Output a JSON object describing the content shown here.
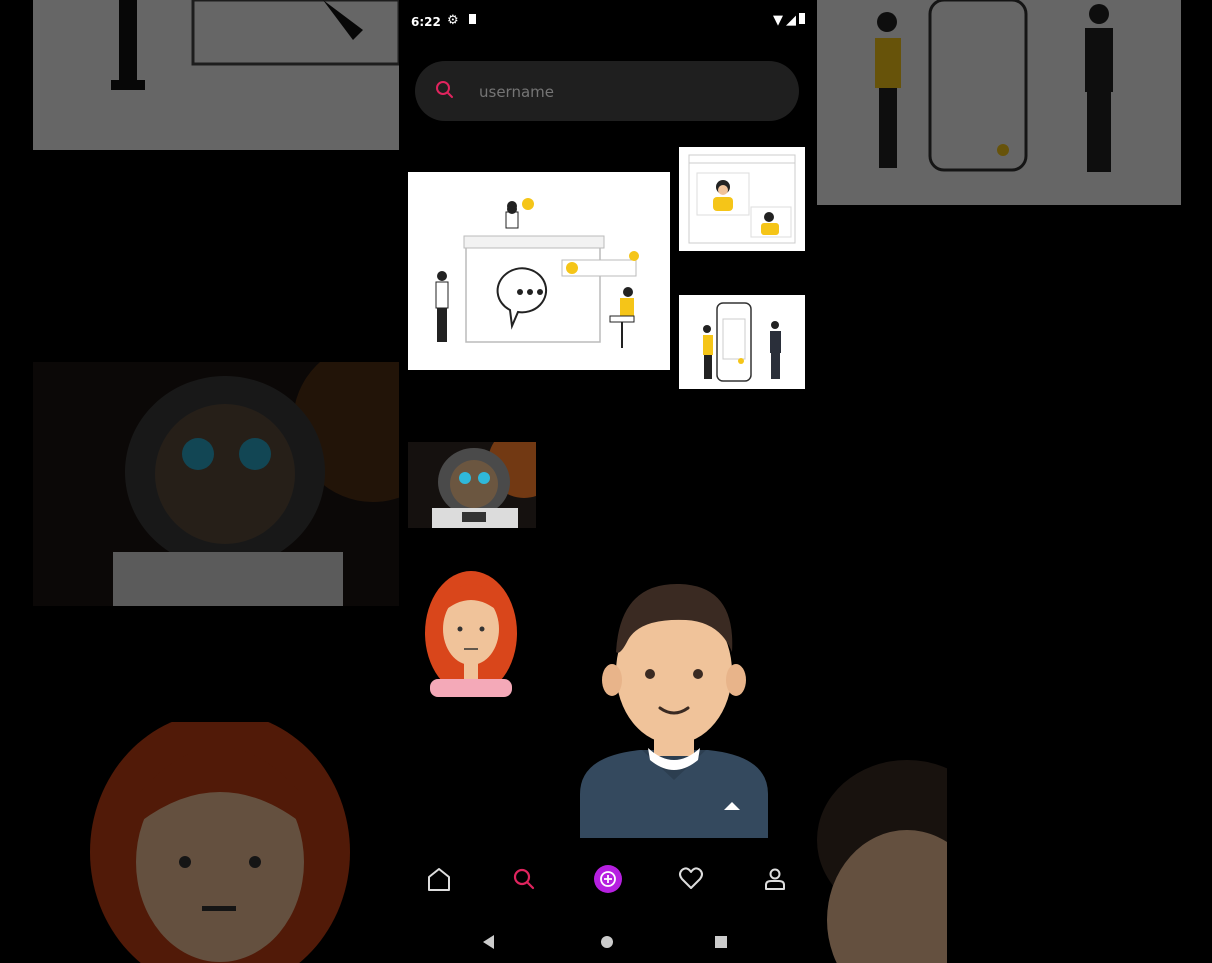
{
  "status_bar": {
    "time": "6:22",
    "left_icons": [
      "settings-icon",
      "sd-card-icon"
    ],
    "right_icons": [
      "wifi-icon",
      "signal-icon",
      "battery-icon"
    ]
  },
  "search": {
    "placeholder": "username",
    "value": ""
  },
  "grid": {
    "tiles": [
      {
        "name": "chat-illustration-tile",
        "kind": "illustration"
      },
      {
        "name": "video-call-illustration-tile",
        "kind": "illustration"
      },
      {
        "name": "phone-people-illustration-tile",
        "kind": "illustration"
      },
      {
        "name": "astronaut-cat-photo-tile",
        "kind": "photo"
      },
      {
        "name": "red-hair-avatar-tile",
        "kind": "avatar"
      },
      {
        "name": "man-avatar-tile",
        "kind": "avatar"
      }
    ]
  },
  "bottom_nav": {
    "items": [
      "home-icon",
      "search-icon",
      "add-post-icon",
      "heart-icon",
      "profile-icon"
    ],
    "active": "search-icon"
  },
  "system_nav": [
    "back-icon",
    "home-circle-icon",
    "recents-icon"
  ],
  "colors": {
    "background": "#000000",
    "search_bar": "#1f1f1f",
    "accent_pink": "#e0245e",
    "accent_purple": "#b620e0",
    "skin": "#f0c39a",
    "hair_red": "#d9461b",
    "yellow": "#f5c518"
  }
}
